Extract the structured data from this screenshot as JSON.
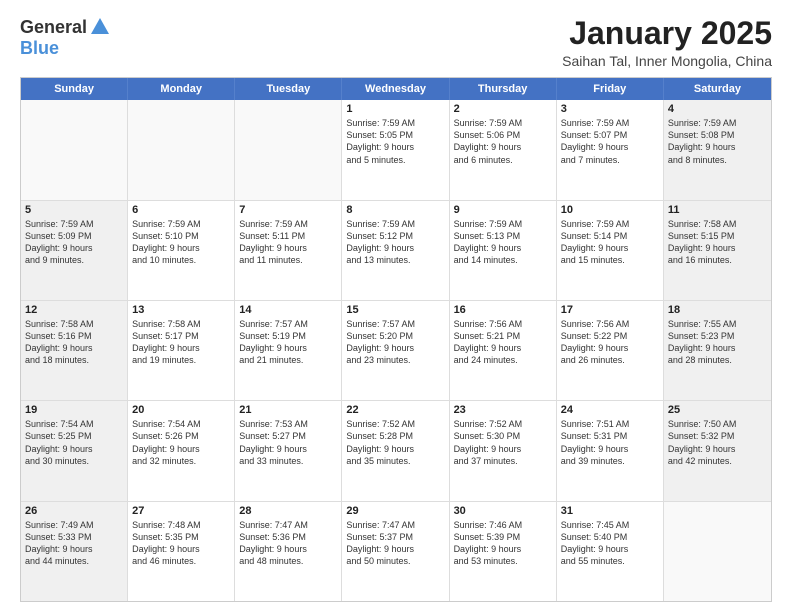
{
  "logo": {
    "general": "General",
    "blue": "Blue"
  },
  "title": "January 2025",
  "subtitle": "Saihan Tal, Inner Mongolia, China",
  "header_days": [
    "Sunday",
    "Monday",
    "Tuesday",
    "Wednesday",
    "Thursday",
    "Friday",
    "Saturday"
  ],
  "weeks": [
    [
      {
        "day": "",
        "lines": [],
        "empty": true
      },
      {
        "day": "",
        "lines": [],
        "empty": true
      },
      {
        "day": "",
        "lines": [],
        "empty": true
      },
      {
        "day": "1",
        "lines": [
          "Sunrise: 7:59 AM",
          "Sunset: 5:05 PM",
          "Daylight: 9 hours",
          "and 5 minutes."
        ]
      },
      {
        "day": "2",
        "lines": [
          "Sunrise: 7:59 AM",
          "Sunset: 5:06 PM",
          "Daylight: 9 hours",
          "and 6 minutes."
        ]
      },
      {
        "day": "3",
        "lines": [
          "Sunrise: 7:59 AM",
          "Sunset: 5:07 PM",
          "Daylight: 9 hours",
          "and 7 minutes."
        ]
      },
      {
        "day": "4",
        "lines": [
          "Sunrise: 7:59 AM",
          "Sunset: 5:08 PM",
          "Daylight: 9 hours",
          "and 8 minutes."
        ]
      }
    ],
    [
      {
        "day": "5",
        "lines": [
          "Sunrise: 7:59 AM",
          "Sunset: 5:09 PM",
          "Daylight: 9 hours",
          "and 9 minutes."
        ]
      },
      {
        "day": "6",
        "lines": [
          "Sunrise: 7:59 AM",
          "Sunset: 5:10 PM",
          "Daylight: 9 hours",
          "and 10 minutes."
        ]
      },
      {
        "day": "7",
        "lines": [
          "Sunrise: 7:59 AM",
          "Sunset: 5:11 PM",
          "Daylight: 9 hours",
          "and 11 minutes."
        ]
      },
      {
        "day": "8",
        "lines": [
          "Sunrise: 7:59 AM",
          "Sunset: 5:12 PM",
          "Daylight: 9 hours",
          "and 13 minutes."
        ]
      },
      {
        "day": "9",
        "lines": [
          "Sunrise: 7:59 AM",
          "Sunset: 5:13 PM",
          "Daylight: 9 hours",
          "and 14 minutes."
        ]
      },
      {
        "day": "10",
        "lines": [
          "Sunrise: 7:59 AM",
          "Sunset: 5:14 PM",
          "Daylight: 9 hours",
          "and 15 minutes."
        ]
      },
      {
        "day": "11",
        "lines": [
          "Sunrise: 7:58 AM",
          "Sunset: 5:15 PM",
          "Daylight: 9 hours",
          "and 16 minutes."
        ]
      }
    ],
    [
      {
        "day": "12",
        "lines": [
          "Sunrise: 7:58 AM",
          "Sunset: 5:16 PM",
          "Daylight: 9 hours",
          "and 18 minutes."
        ]
      },
      {
        "day": "13",
        "lines": [
          "Sunrise: 7:58 AM",
          "Sunset: 5:17 PM",
          "Daylight: 9 hours",
          "and 19 minutes."
        ]
      },
      {
        "day": "14",
        "lines": [
          "Sunrise: 7:57 AM",
          "Sunset: 5:19 PM",
          "Daylight: 9 hours",
          "and 21 minutes."
        ]
      },
      {
        "day": "15",
        "lines": [
          "Sunrise: 7:57 AM",
          "Sunset: 5:20 PM",
          "Daylight: 9 hours",
          "and 23 minutes."
        ]
      },
      {
        "day": "16",
        "lines": [
          "Sunrise: 7:56 AM",
          "Sunset: 5:21 PM",
          "Daylight: 9 hours",
          "and 24 minutes."
        ]
      },
      {
        "day": "17",
        "lines": [
          "Sunrise: 7:56 AM",
          "Sunset: 5:22 PM",
          "Daylight: 9 hours",
          "and 26 minutes."
        ]
      },
      {
        "day": "18",
        "lines": [
          "Sunrise: 7:55 AM",
          "Sunset: 5:23 PM",
          "Daylight: 9 hours",
          "and 28 minutes."
        ]
      }
    ],
    [
      {
        "day": "19",
        "lines": [
          "Sunrise: 7:54 AM",
          "Sunset: 5:25 PM",
          "Daylight: 9 hours",
          "and 30 minutes."
        ]
      },
      {
        "day": "20",
        "lines": [
          "Sunrise: 7:54 AM",
          "Sunset: 5:26 PM",
          "Daylight: 9 hours",
          "and 32 minutes."
        ]
      },
      {
        "day": "21",
        "lines": [
          "Sunrise: 7:53 AM",
          "Sunset: 5:27 PM",
          "Daylight: 9 hours",
          "and 33 minutes."
        ]
      },
      {
        "day": "22",
        "lines": [
          "Sunrise: 7:52 AM",
          "Sunset: 5:28 PM",
          "Daylight: 9 hours",
          "and 35 minutes."
        ]
      },
      {
        "day": "23",
        "lines": [
          "Sunrise: 7:52 AM",
          "Sunset: 5:30 PM",
          "Daylight: 9 hours",
          "and 37 minutes."
        ]
      },
      {
        "day": "24",
        "lines": [
          "Sunrise: 7:51 AM",
          "Sunset: 5:31 PM",
          "Daylight: 9 hours",
          "and 39 minutes."
        ]
      },
      {
        "day": "25",
        "lines": [
          "Sunrise: 7:50 AM",
          "Sunset: 5:32 PM",
          "Daylight: 9 hours",
          "and 42 minutes."
        ]
      }
    ],
    [
      {
        "day": "26",
        "lines": [
          "Sunrise: 7:49 AM",
          "Sunset: 5:33 PM",
          "Daylight: 9 hours",
          "and 44 minutes."
        ]
      },
      {
        "day": "27",
        "lines": [
          "Sunrise: 7:48 AM",
          "Sunset: 5:35 PM",
          "Daylight: 9 hours",
          "and 46 minutes."
        ]
      },
      {
        "day": "28",
        "lines": [
          "Sunrise: 7:47 AM",
          "Sunset: 5:36 PM",
          "Daylight: 9 hours",
          "and 48 minutes."
        ]
      },
      {
        "day": "29",
        "lines": [
          "Sunrise: 7:47 AM",
          "Sunset: 5:37 PM",
          "Daylight: 9 hours",
          "and 50 minutes."
        ]
      },
      {
        "day": "30",
        "lines": [
          "Sunrise: 7:46 AM",
          "Sunset: 5:39 PM",
          "Daylight: 9 hours",
          "and 53 minutes."
        ]
      },
      {
        "day": "31",
        "lines": [
          "Sunrise: 7:45 AM",
          "Sunset: 5:40 PM",
          "Daylight: 9 hours",
          "and 55 minutes."
        ]
      },
      {
        "day": "",
        "lines": [],
        "empty": true
      }
    ]
  ],
  "colors": {
    "header_bg": "#4472c4",
    "shaded": "#f0f0f0"
  }
}
